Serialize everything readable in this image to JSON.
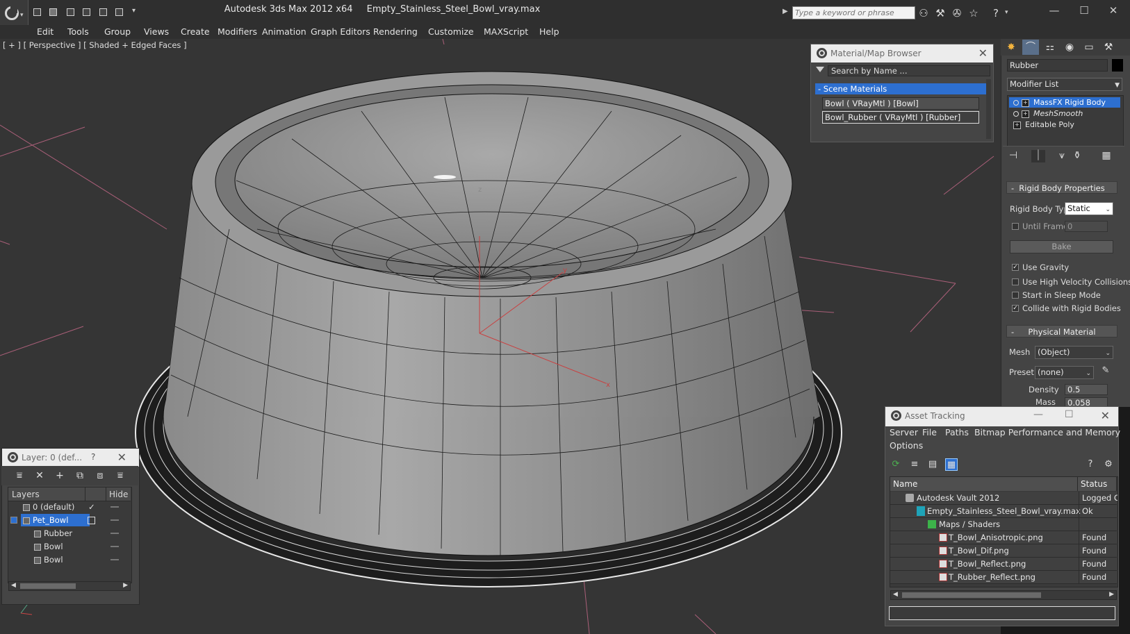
{
  "titlebar": {
    "app_title": "Autodesk 3ds Max  2012 x64",
    "file_name": "Empty_Stainless_Steel_Bowl_vray.max",
    "search_placeholder": "Type a keyword or phrase"
  },
  "menu": [
    "Edit",
    "Tools",
    "Group",
    "Views",
    "Create",
    "Modifiers",
    "Animation",
    "Graph Editors",
    "Rendering",
    "Customize",
    "MAXScript",
    "Help"
  ],
  "viewport": {
    "label": "[ + ] [ Perspective ] [ Shaded + Edged Faces ]",
    "gizmo_z": "z",
    "gizmo_x": "x",
    "gizmo_y": "y"
  },
  "material_browser": {
    "title": "Material/Map Browser",
    "search": "Search by Name ...",
    "section": "- Scene Materials",
    "materials": [
      "Bowl  ( VRayMtl ) [Bowl]",
      "Bowl_Rubber  ( VRayMtl ) [Rubber]"
    ]
  },
  "command_panel": {
    "object_name": "Rubber",
    "object_color": "#000000",
    "modifier_list": "Modifier List",
    "stack": [
      "MassFX Rigid Body",
      "MeshSmooth",
      "Editable Poly"
    ],
    "rigid_body": {
      "header": "Rigid Body Properties",
      "type_label": "Rigid Body Type",
      "type_value": "Static",
      "until_frame_label": "Until Frame",
      "until_frame_value": "0",
      "bake_label": "Bake",
      "options": [
        {
          "label": "Use Gravity",
          "checked": true
        },
        {
          "label": "Use High Velocity Collisions",
          "checked": false
        },
        {
          "label": "Start in Sleep Mode",
          "checked": false
        },
        {
          "label": "Collide with Rigid Bodies",
          "checked": true
        }
      ]
    },
    "physical_material": {
      "header": "Physical Material",
      "mesh_label": "Mesh",
      "mesh_value": "(Object)",
      "preset_label": "Preset",
      "preset_value": "(none)",
      "density_label": "Density",
      "density_value": "0.5",
      "mass_label": "Mass",
      "mass_value": "0.058"
    }
  },
  "layer_panel": {
    "title": "Layer: 0 (def...",
    "help": "?",
    "col_layers": "Layers",
    "col_hide": "Hide",
    "rows": [
      {
        "name": "0 (default)",
        "indent": 1,
        "selected": false,
        "check": "✓"
      },
      {
        "name": "Pet_Bowl",
        "indent": 1,
        "selected": true,
        "check": ""
      },
      {
        "name": "Rubber",
        "indent": 2,
        "selected": false,
        "check": ""
      },
      {
        "name": "Bowl",
        "indent": 2,
        "selected": false,
        "check": ""
      },
      {
        "name": "Bowl",
        "indent": 2,
        "selected": false,
        "check": ""
      }
    ]
  },
  "asset_tracking": {
    "title": "Asset Tracking",
    "menu": [
      "Server",
      "File",
      "Paths",
      "Bitmap Performance and Memory",
      "Options"
    ],
    "col_name": "Name",
    "col_status": "Status",
    "rows": [
      {
        "name": "Autodesk Vault 2012",
        "status": "Logged O",
        "indent": 1,
        "icon": "vault"
      },
      {
        "name": "Empty_Stainless_Steel_Bowl_vray.max",
        "status": "Ok",
        "indent": 2,
        "icon": "max"
      },
      {
        "name": "Maps / Shaders",
        "status": "",
        "indent": 3,
        "icon": "folder"
      },
      {
        "name": "T_Bowl_Anisotropic.png",
        "status": "Found",
        "indent": 4,
        "icon": "png"
      },
      {
        "name": "T_Bowl_Dif.png",
        "status": "Found",
        "indent": 4,
        "icon": "png"
      },
      {
        "name": "T_Bowl_Reflect.png",
        "status": "Found",
        "indent": 4,
        "icon": "png"
      },
      {
        "name": "T_Rubber_Reflect.png",
        "status": "Found",
        "indent": 4,
        "icon": "png"
      }
    ]
  }
}
